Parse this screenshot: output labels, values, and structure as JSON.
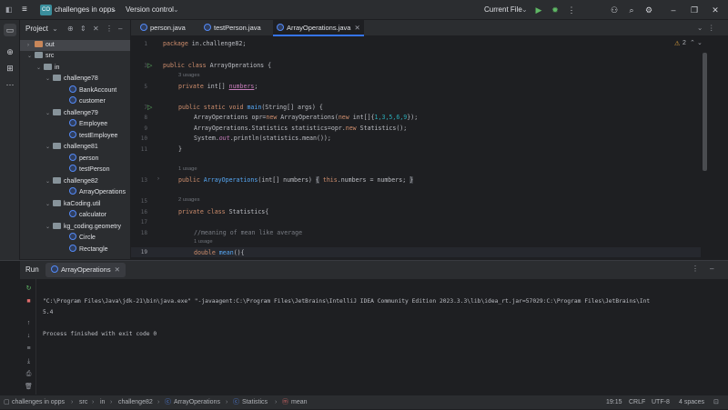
{
  "titlebar": {
    "project_badge": "CO",
    "project_name": "challenges in opps",
    "vcs": "Version control",
    "run_config": "Current File"
  },
  "project_panel": {
    "title": "Project",
    "tree": [
      {
        "label": "out",
        "kind": "folder-orange"
      },
      {
        "label": "src",
        "kind": "folder"
      },
      {
        "label": "in",
        "kind": "folder"
      },
      {
        "label": "challenge78",
        "kind": "package"
      },
      {
        "label": "BankAccount",
        "kind": "class"
      },
      {
        "label": "customer",
        "kind": "class"
      },
      {
        "label": "challenge79",
        "kind": "package"
      },
      {
        "label": "Employee",
        "kind": "class"
      },
      {
        "label": "testEmployee",
        "kind": "class"
      },
      {
        "label": "challenge81",
        "kind": "package"
      },
      {
        "label": "person",
        "kind": "class"
      },
      {
        "label": "testPerson",
        "kind": "class"
      },
      {
        "label": "challenge82",
        "kind": "package"
      },
      {
        "label": "ArrayOperations",
        "kind": "class"
      },
      {
        "label": "kaCoding.util",
        "kind": "package"
      },
      {
        "label": "calculator",
        "kind": "class"
      },
      {
        "label": "kg_coding.geometry",
        "kind": "package"
      },
      {
        "label": "Circle",
        "kind": "class"
      },
      {
        "label": "Rectangle",
        "kind": "class"
      }
    ]
  },
  "tabs": [
    {
      "label": "person.java"
    },
    {
      "label": "testPerson.java"
    },
    {
      "label": "ArrayOperations.java"
    }
  ],
  "editor": {
    "warnings": "2",
    "lines": {
      "l1": "1",
      "l3": "3",
      "l5": "5",
      "l7": "7",
      "l8": "8",
      "l9": "9",
      "l10": "10",
      "l11": "11",
      "l13": "13",
      "l15": "15",
      "l16": "16",
      "l17": "17",
      "l18": "18",
      "l19": "19"
    },
    "hint_3usages": "3 usages",
    "hint_1usage_a": "1 usage",
    "hint_2usages": "2 usages",
    "hint_1usage_b": "1 usage",
    "code": {
      "pkg_kw": "package",
      "pkg_name": " in.challenge82;",
      "cls_kw": "public class",
      "cls_name": " ArrayOperations {",
      "fld_kw": "private",
      "fld_type": " int[] ",
      "fld_name": "numbers",
      "fld_end": ";",
      "main_kw": "public static void ",
      "main_name": "main",
      "main_args": "(String[] args) {",
      "l7_a": "ArrayOperations opr=",
      "l7_new": "new",
      "l7_b": " ArrayOperations(",
      "l7_new2": "new",
      "l7_c": " int[]{",
      "l7_nums": "1,3,5,6,9",
      "l7_d": "});",
      "l8_a": "ArrayOperations.Statistics statistics=opr.",
      "l8_new": "new",
      "l8_b": " Statistics();",
      "l9_a": "System.",
      "l9_out": "out",
      "l9_b": ".println(statistics.mean());",
      "l10": "}",
      "l13_kw": "public ",
      "l13_name": "ArrayOperations",
      "l13_a": "(int[] numbers) ",
      "l13_body_kw": "this",
      "l13_body": ".numbers = numbers; ",
      "l13_open": "{",
      "l13_close": "}",
      "l16_kw": "private class",
      "l16_b": " Statistics{",
      "l18_cmt": "//meaning of mean like average",
      "l19_kw": "double ",
      "l19_name": "mean",
      "l19_b": "(){"
    }
  },
  "run": {
    "title": "Run",
    "config_tab": "ArrayOperations",
    "out_cmd": "\"C:\\Program Files\\Java\\jdk-21\\bin\\java.exe\" \"-javaagent:C:\\Program Files\\JetBrains\\IntelliJ IDEA Community Edition 2023.3.3\\lib\\idea_rt.jar=57029:C:\\Program Files\\JetBrains\\Int",
    "out_result": "5.4",
    "out_exit": "Process finished with exit code 0"
  },
  "statusbar": {
    "crumbs": [
      "challenges in opps",
      "src",
      "in",
      "challenge82",
      "ArrayOperations",
      "Statistics",
      "mean"
    ],
    "position": "19:15",
    "line_sep": "CRLF",
    "encoding": "UTF-8",
    "indent": "4 spaces"
  },
  "colors": {
    "accent": "#3574f0",
    "keyword": "#cf8e6d",
    "function": "#56a8f5",
    "field": "#c77dbb",
    "number": "#2aacb8"
  }
}
